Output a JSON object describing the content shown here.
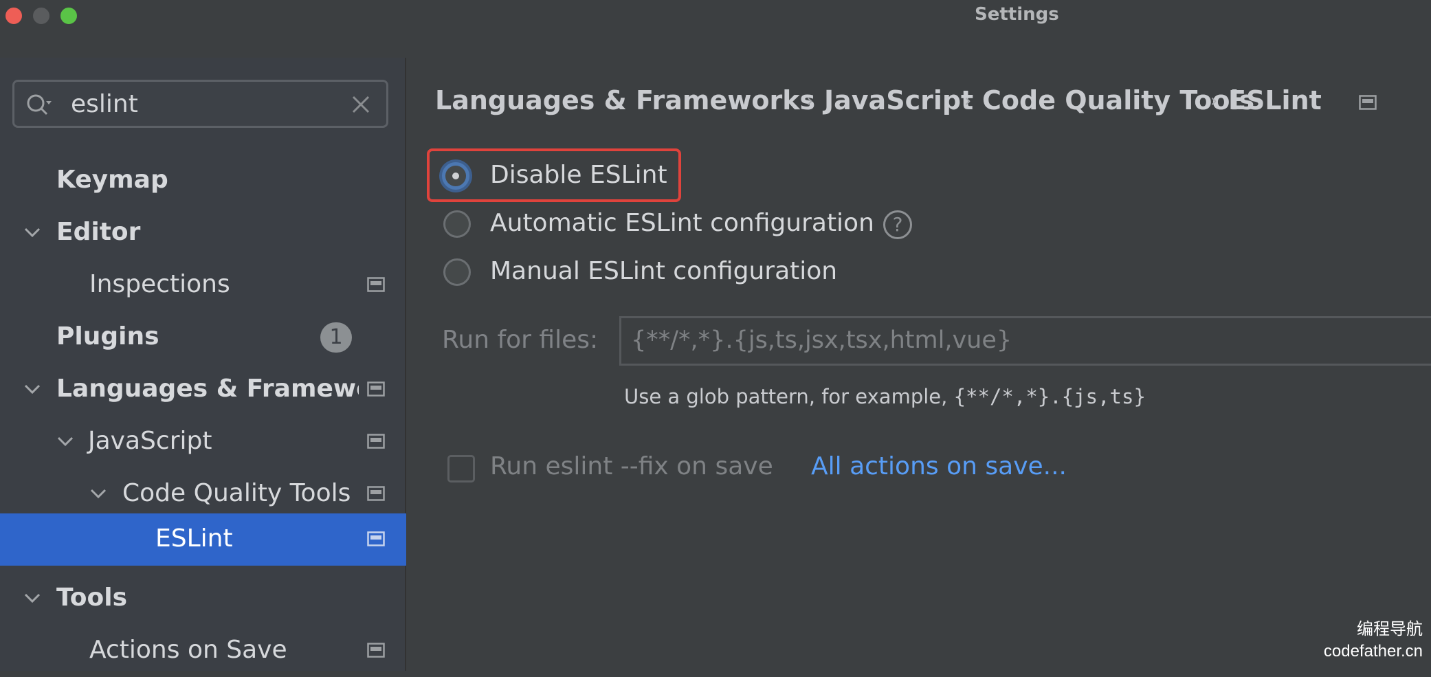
{
  "window": {
    "title": "Settings"
  },
  "search": {
    "value": "eslint"
  },
  "sidebar": {
    "items": [
      {
        "label": "Keymap"
      },
      {
        "label": "Editor"
      },
      {
        "label": "Inspections"
      },
      {
        "label": "Plugins",
        "badge": "1"
      },
      {
        "label": "Languages & Frameworks"
      },
      {
        "label": "JavaScript"
      },
      {
        "label": "Code Quality Tools"
      },
      {
        "label": "ESLint"
      },
      {
        "label": "Tools"
      },
      {
        "label": "Actions on Save"
      }
    ]
  },
  "breadcrumb": [
    "Languages & Frameworks",
    "JavaScript",
    "Code Quality Tools",
    "ESLint"
  ],
  "options": {
    "disable": "Disable ESLint",
    "automatic": "Automatic ESLint configuration",
    "manual": "Manual ESLint configuration"
  },
  "run_for_files": {
    "label": "Run for files:",
    "value": "{**/*,*}.{js,ts,jsx,tsx,html,vue}",
    "hint_prefix": "Use a glob pattern, for example, ",
    "hint_example": "{**/*,*}.{js,ts}"
  },
  "fix_on_save": {
    "label": "Run eslint --fix on save",
    "link": "All actions on save..."
  },
  "watermark": {
    "line1": "编程导航",
    "line2": "codefather.cn"
  },
  "colors": {
    "accent": "#2f65ca",
    "link": "#589df6",
    "highlight": "#e0433c"
  }
}
